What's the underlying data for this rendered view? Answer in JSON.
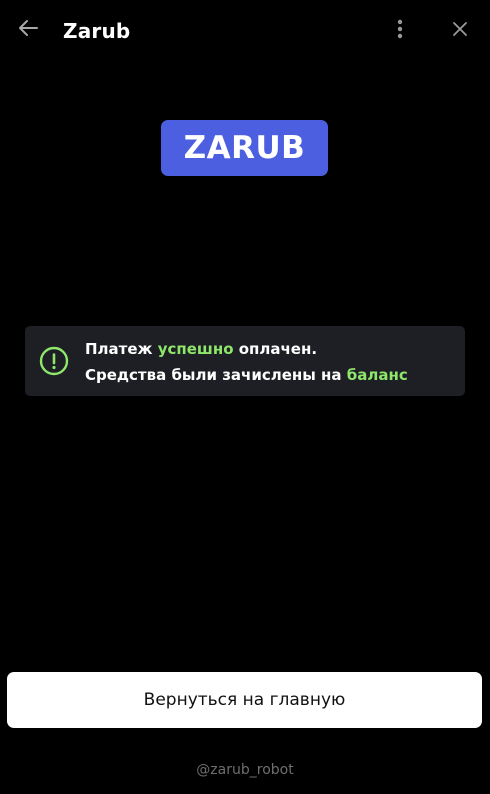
{
  "header": {
    "title": "Zarub",
    "back_icon": "arrow-left-icon",
    "menu_icon": "more-vertical-icon",
    "close_icon": "close-icon"
  },
  "logo": {
    "text": "ZARUB",
    "color": "#4c5fe0"
  },
  "notice": {
    "icon": "check-circle-icon",
    "line1": {
      "before": "Платеж ",
      "highlight": "успешно",
      "after": " оплачен."
    },
    "line2": {
      "before": "Средства были зачислены на ",
      "highlight": "баланс"
    },
    "highlight_color": "#8ee66b",
    "background": "#1d1f24"
  },
  "main_button": {
    "label": "Вернуться на главную"
  },
  "footer": {
    "handle": "@zarub_robot"
  }
}
